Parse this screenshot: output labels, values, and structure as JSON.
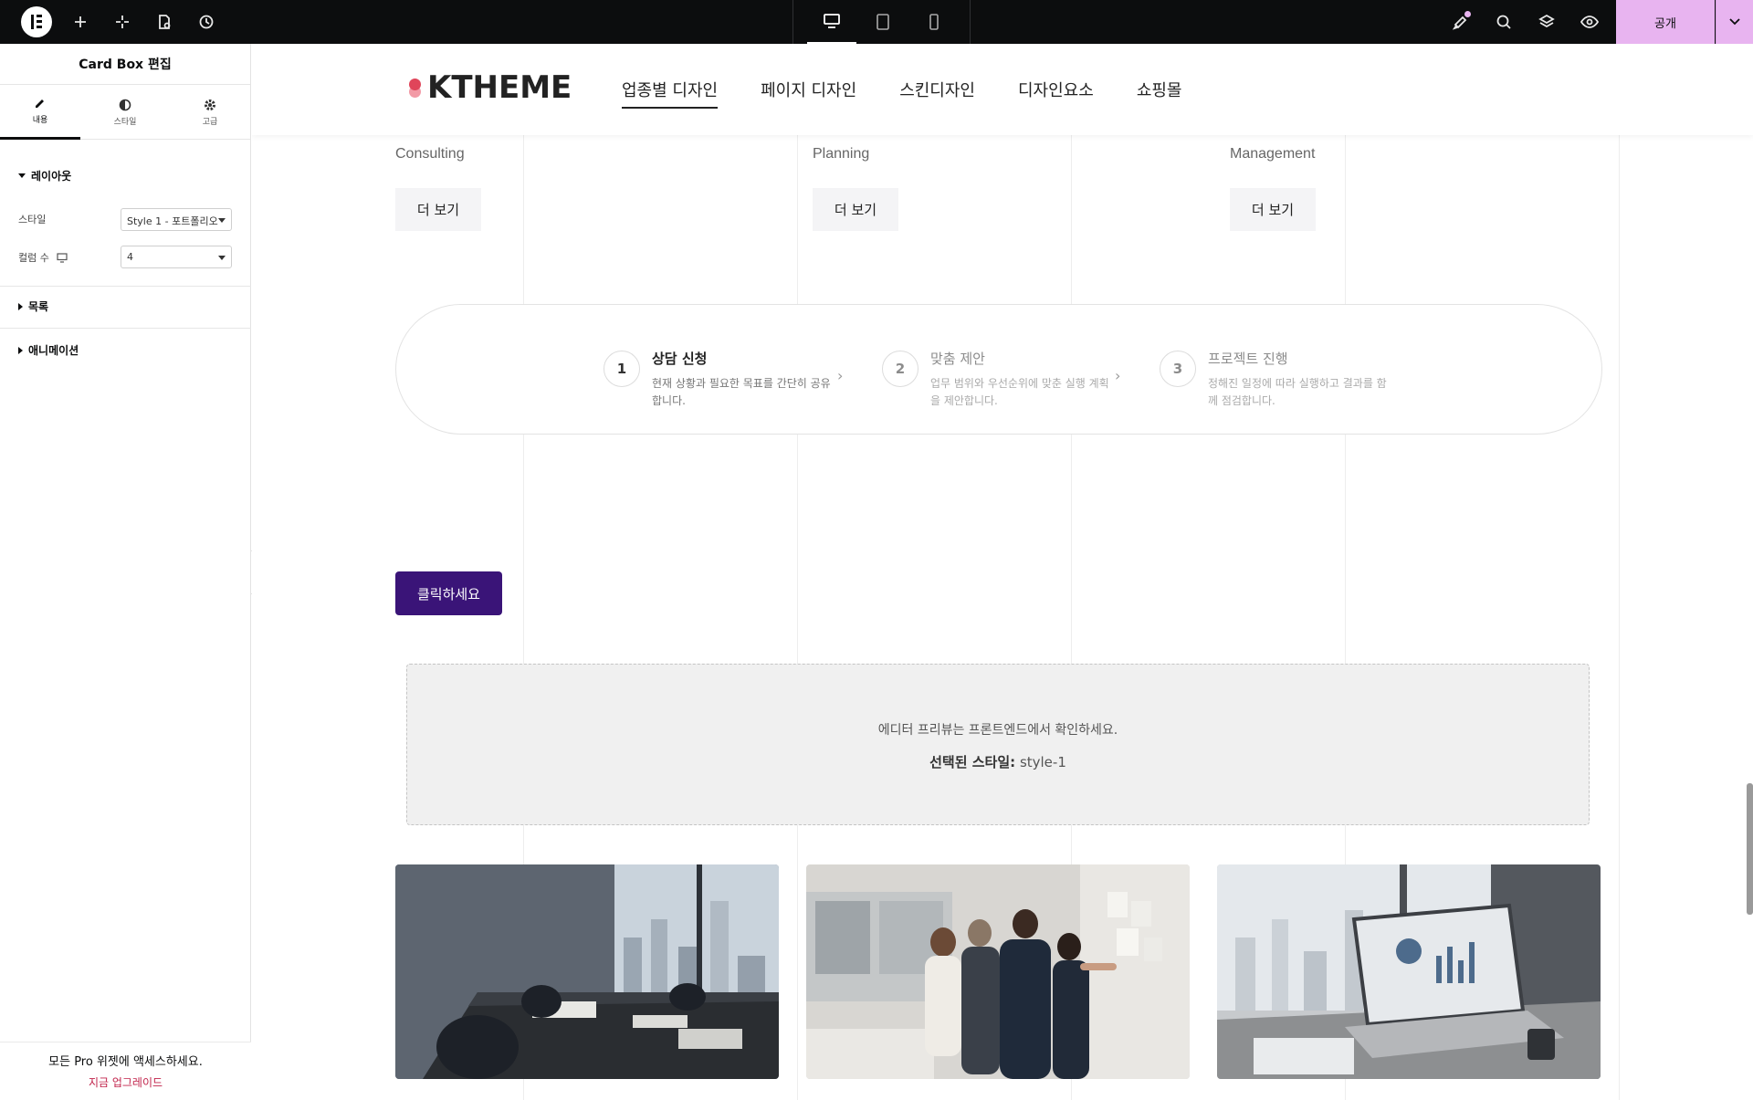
{
  "topbar": {
    "publish_label": "공개",
    "accent": "#e8b4f0"
  },
  "panel": {
    "title": "Card Box 편집",
    "tabs": [
      {
        "label": "내용",
        "icon": "pencil-icon"
      },
      {
        "label": "스타일",
        "icon": "half-circle-icon"
      },
      {
        "label": "고급",
        "icon": "gear-icon"
      }
    ],
    "sections": {
      "layout": "레이아웃",
      "list": "목록",
      "animation": "애니메이션"
    },
    "controls": {
      "style_label": "스타일",
      "style_value": "Style 1 - 포트폴리오",
      "columns_label": "컬럼 수",
      "columns_value": "4"
    },
    "pro": {
      "text": "모든 Pro 위젯에 액세스하세요.",
      "link": "지금 업그레이드"
    }
  },
  "site": {
    "brand": "KTHEME",
    "nav": [
      "업종별 디자인",
      "페이지 디자인",
      "스킨디자인",
      "디자인요소",
      "쇼핑몰"
    ],
    "cards": [
      {
        "label": "Consulting",
        "button": "더 보기"
      },
      {
        "label": "Planning",
        "button": "더 보기"
      },
      {
        "label": "Management",
        "button": "더 보기"
      }
    ],
    "steps": [
      {
        "num": "1",
        "title": "상담 신청",
        "desc": "현재 상황과 필요한 목표를 간단히 공유합니다."
      },
      {
        "num": "2",
        "title": "맞춤 제안",
        "desc": "업무 범위와 우선순위에 맞춘 실행 계획을 제안합니다."
      },
      {
        "num": "3",
        "title": "프로젝트 진행",
        "desc": "정해진 일정에 따라 실행하고 결과를 함께 점검합니다."
      }
    ],
    "cta": "클릭하세요",
    "notice": {
      "line1": "에디터 프리뷰는 프론트엔드에서 확인하세요.",
      "label": "선택된 스타일:",
      "value": "style-1"
    },
    "brand_colors": {
      "dot": "#e0455a",
      "cta": "#3a1478"
    }
  },
  "floating": [
    {
      "icon": "phone-icon",
      "color": "#4caf50"
    },
    {
      "icon": "chat-bubble-icon",
      "color": "#f7d02c"
    },
    {
      "icon": "instagram-icon",
      "color": "#c13584"
    },
    {
      "icon": "scroll-top-icon",
      "color": "#3a1478"
    }
  ]
}
